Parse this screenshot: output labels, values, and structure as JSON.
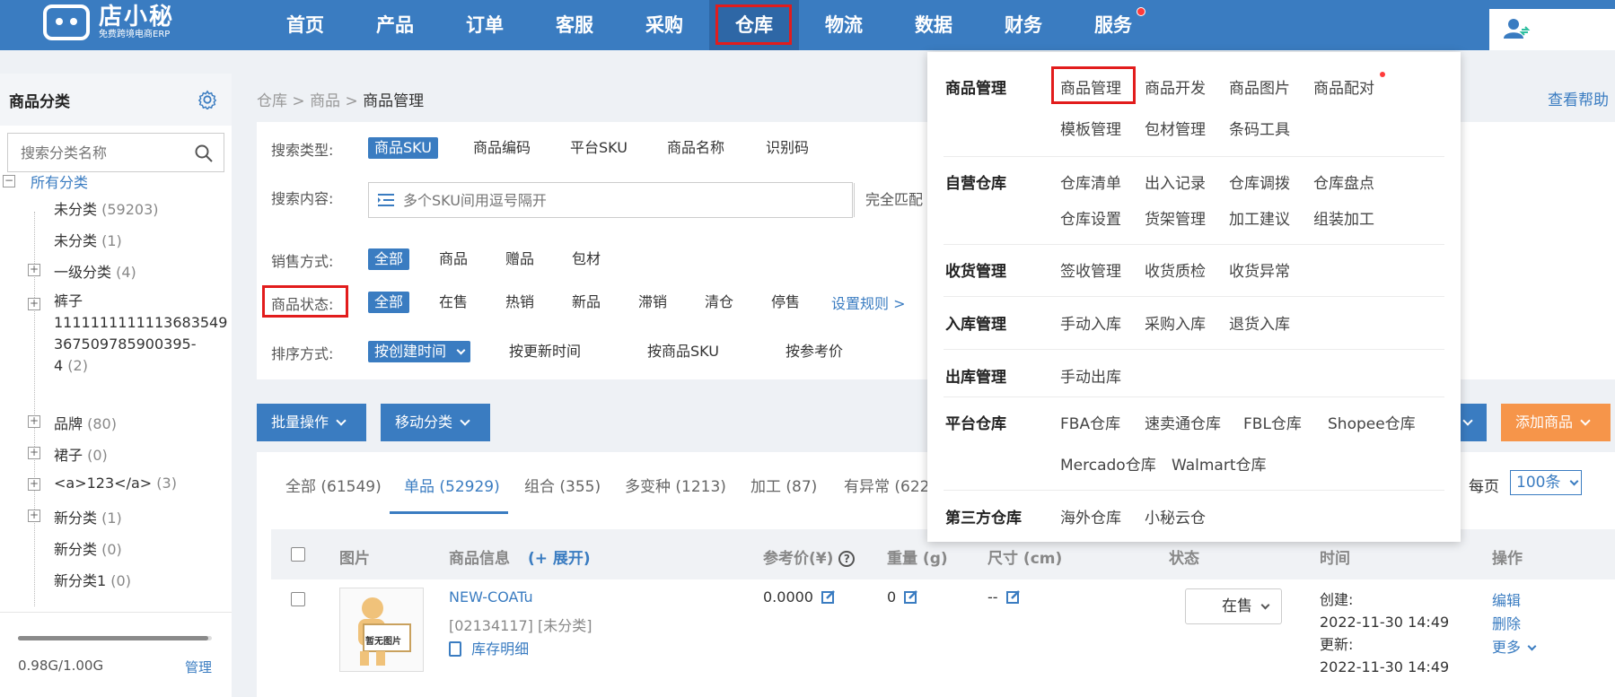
{
  "app": {
    "logo_title": "店小秘",
    "logo_subtitle": "免费跨境电商ERP"
  },
  "nav": [
    {
      "label": "首页"
    },
    {
      "label": "产品"
    },
    {
      "label": "订单"
    },
    {
      "label": "客服"
    },
    {
      "label": "采购"
    },
    {
      "label": "仓库",
      "active": true
    },
    {
      "label": "物流"
    },
    {
      "label": "数据"
    },
    {
      "label": "财务"
    },
    {
      "label": "服务",
      "badge": true
    }
  ],
  "sidebar": {
    "title": "商品分类",
    "search_placeholder": "搜索分类名称",
    "tree": {
      "root": "所有分类",
      "items": [
        {
          "label": "未分类",
          "count": "(59203)"
        },
        {
          "label": "未分类",
          "count": "(1)"
        },
        {
          "label": "一级分类",
          "count": "(4)"
        },
        {
          "label": "裤子",
          "line2": "1111111111113683549",
          "line3": "367509785900395-",
          "line4": "4",
          "count": "(2)"
        },
        {
          "label": "品牌",
          "count": "(80)"
        },
        {
          "label": "裙子",
          "count": "(0)"
        },
        {
          "label": "<a>123</a>",
          "count": "(3)"
        },
        {
          "label": "新分类",
          "count": "(1)"
        },
        {
          "label": "新分类",
          "count": "(0)"
        },
        {
          "label": "新分类1",
          "count": "(0)"
        }
      ]
    },
    "storage_text": "0.98G/1.00G",
    "storage_used_fraction": 0.98,
    "manage_label": "管理"
  },
  "breadcrumb": {
    "items": [
      "仓库",
      "商品"
    ],
    "current": "商品管理",
    "sep": ">"
  },
  "help_label": "查看帮助",
  "filter": {
    "search_type_label": "搜索类型:",
    "search_types": [
      "商品SKU",
      "商品编码",
      "平台SKU",
      "商品名称",
      "识别码"
    ],
    "search_content_label": "搜索内容:",
    "search_placeholder": "多个SKU间用逗号隔开",
    "match_label": "完全匹配",
    "sale_label": "销售方式:",
    "sale_options": [
      "全部",
      "商品",
      "赠品",
      "包材"
    ],
    "status_label": "商品状态:",
    "status_options": [
      "全部",
      "在售",
      "热销",
      "新品",
      "滞销",
      "清仓",
      "停售"
    ],
    "rule_link": "设置规则 >",
    "sort_label": "排序方式:",
    "sort_options": [
      "按创建时间",
      "按更新时间",
      "按商品SKU",
      "按参考价"
    ]
  },
  "actions": {
    "batch": "批量操作",
    "move": "移动分类",
    "add": "添加商品"
  },
  "tabs": [
    {
      "label": "全部 (61549)"
    },
    {
      "label": "单品 (52929)",
      "active": true
    },
    {
      "label": "组合 (355)"
    },
    {
      "label": "多变种 (1213)"
    },
    {
      "label": "加工 (87)"
    },
    {
      "label": "有异常 (622"
    }
  ],
  "perpage": {
    "label": "每页",
    "value": "100条"
  },
  "table": {
    "headers": {
      "image": "图片",
      "info": "商品信息",
      "expand": "(+ 展开)",
      "price": "参考价(¥)",
      "weight": "重量 (g)",
      "size": "尺寸 (cm)",
      "status": "状态",
      "time": "时间",
      "ops": "操作"
    },
    "rows": [
      {
        "sku": "NEW-COATu",
        "code": "[02134117]",
        "category": "[未分类]",
        "stock_link": "库存明细",
        "thumb_text": "暂无图片",
        "price": "0.0000",
        "weight": "0",
        "size": "--",
        "status": "在售",
        "created_label": "创建:",
        "created": "2022-11-30 14:49",
        "updated_label": "更新:",
        "updated": "2022-11-30 14:49",
        "op_edit": "编辑",
        "op_delete": "删除",
        "op_more": "更多"
      }
    ]
  },
  "dropdown": {
    "sections": [
      {
        "title": "商品管理",
        "items": [
          "商品管理",
          "商品开发",
          "商品图片",
          "商品配对",
          "模板管理",
          "包材管理",
          "条码工具"
        ]
      },
      {
        "title": "自营仓库",
        "items": [
          "仓库清单",
          "出入记录",
          "仓库调拨",
          "仓库盘点",
          "仓库设置",
          "货架管理",
          "加工建议",
          "组装加工"
        ]
      },
      {
        "title": "收货管理",
        "items": [
          "签收管理",
          "收货质检",
          "收货异常"
        ]
      },
      {
        "title": "入库管理",
        "items": [
          "手动入库",
          "采购入库",
          "退货入库"
        ]
      },
      {
        "title": "出库管理",
        "items": [
          "手动出库"
        ]
      },
      {
        "title": "平台仓库",
        "items": [
          "FBA仓库",
          "速卖通仓库",
          "FBL仓库",
          "Shopee仓库",
          "Mercado仓库",
          "Walmart仓库"
        ]
      },
      {
        "title": "第三方仓库",
        "items": [
          "海外仓库",
          "小秘云仓"
        ]
      }
    ]
  },
  "colors": {
    "primary": "#3a7cc1",
    "accent_orange": "#f6954a",
    "highlight_red": "#e21c1c"
  }
}
